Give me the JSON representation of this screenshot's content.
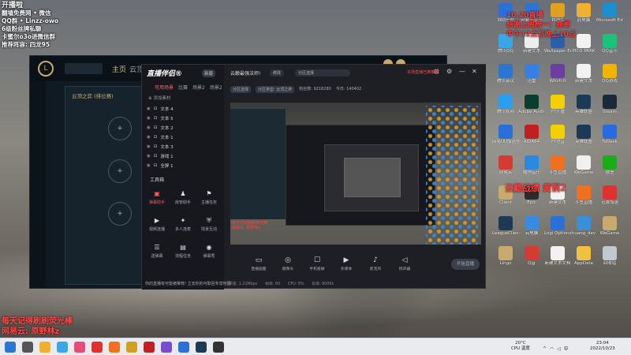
{
  "overlay": {
    "top_left": [
      "开播啦",
      "翻墙免费网 • 微信",
      "QQ群 • Linzz-owo",
      "6级粉丝牌私聊",
      "卡蜜尔o3o进微信群",
      "推荐阵容: 四龙95"
    ],
    "top_right": [
      "10.20直播",
      "感谢上周榜一：鹿哥",
      "中午12点到晚上10点"
    ],
    "mid_right": "云巅战绩   黄铜2",
    "bottom_left": [
      "每天记得刷刷荧光棒",
      "网易云: 原野林z"
    ]
  },
  "lol_client": {
    "logo": "L",
    "nav_home": "主页",
    "nav_cloud": "云顶",
    "panel_title": "云顶之弈 (排位赛)",
    "slot_symbol": "+"
  },
  "stream_app": {
    "title": "直播伴侣®",
    "badge": "新版",
    "tabs": [
      "可用场景",
      "比赛",
      "场景2",
      "场景2"
    ],
    "add_source": "添加素材",
    "layers": [
      "文本 4",
      "文本 5",
      "文本 2",
      "文本 1",
      "文本 3",
      "游戏 1",
      "全屏 1"
    ],
    "tools_title": "工具箱",
    "tools": [
      {
        "icon": "chart-icon",
        "glyph": "▣",
        "label": "弹幕助手"
      },
      {
        "icon": "user-icon",
        "glyph": "♟",
        "label": "房管助手"
      },
      {
        "icon": "flag-icon",
        "glyph": "⚑",
        "label": "主播任务"
      },
      {
        "icon": "video-icon",
        "glyph": "▶",
        "label": "视频连播"
      },
      {
        "icon": "rocket-icon",
        "glyph": "✦",
        "label": "多人连麦"
      },
      {
        "icon": "shield-icon",
        "glyph": "⛨",
        "label": "情景互动"
      },
      {
        "icon": "vote-icon",
        "glyph": "☰",
        "label": "送弹幕"
      },
      {
        "icon": "document-icon",
        "glyph": "▤",
        "label": "流程任务"
      },
      {
        "icon": "camera-icon",
        "glyph": "◉",
        "label": "弹幕秀"
      }
    ],
    "notice": "你的直播有可能被推荐! 立去你的可取回专享地图",
    "room_name": "云巅最强法师!",
    "pill_1": "修改",
    "pill_2": "分区选择",
    "warning": "本场直播已被推荐",
    "info_tags": [
      "分区选择",
      "分区类型: 云顶之弈"
    ],
    "info_values": [
      "粉丝数: 9216280",
      "今日: 140402"
    ],
    "preview_red": [
      "每天记得刷刷荧光棒",
      "网易云: 原野林z"
    ],
    "controls": [
      {
        "icon": "screen-icon",
        "glyph": "▭",
        "label": "直播画面"
      },
      {
        "icon": "camera-icon",
        "glyph": "◎",
        "label": "摄像头"
      },
      {
        "icon": "phone-icon",
        "glyph": "☐",
        "label": "手机投屏"
      },
      {
        "icon": "media-icon",
        "glyph": "▶",
        "label": "多媒体"
      },
      {
        "icon": "mic-icon",
        "glyph": "♪",
        "label": "麦克风"
      },
      {
        "icon": "speaker-icon",
        "glyph": "◁",
        "label": "扬声器"
      }
    ],
    "go_live": "开始直播",
    "status": [
      "带宽:    1.21Mbps",
      "帧率: 60",
      "CPU: 8%",
      "码率: 8000k"
    ]
  },
  "desktop_icons": [
    {
      "label": "360压缩",
      "color": "#2a70d8"
    },
    {
      "label": "网易云音乐",
      "color": "#2a76d2"
    },
    {
      "label": "PUBG",
      "color": "#e0a020"
    },
    {
      "label": "此电脑",
      "color": "#f0b030"
    },
    {
      "label": "Microsoft Edge",
      "color": "#1b8fd1"
    },
    {
      "label": "腾讯QQ",
      "color": "#3aa6e8"
    },
    {
      "label": "新建文本",
      "color": "#eeeeee"
    },
    {
      "label": "Wallpaper Engine",
      "color": "#2b5fa8"
    },
    {
      "label": "PICO PARK",
      "color": "#f2f2f2"
    },
    {
      "label": "QQ音乐",
      "color": "#19c37a"
    },
    {
      "label": "腾讯会议",
      "color": "#2a76d2"
    },
    {
      "label": "迅雷",
      "color": "#3580e0"
    },
    {
      "label": "Witch It",
      "color": "#6b3fa0"
    },
    {
      "label": "新建文本",
      "color": "#f2f2f2"
    },
    {
      "label": "QQ游戏",
      "color": "#f2b400"
    },
    {
      "label": "腾讯视频",
      "color": "#2a9ef0"
    },
    {
      "label": "Adobe Audition",
      "color": "#0b3d2e"
    },
    {
      "label": "YY开播",
      "color": "#f5d000"
    },
    {
      "label": "英雄联盟",
      "color": "#1c3a56"
    },
    {
      "label": "Steam",
      "color": "#1b2838"
    },
    {
      "label": "网易UU加速器",
      "color": "#2a70d8"
    },
    {
      "label": "AIDA64",
      "color": "#c02020"
    },
    {
      "label": "YY语音",
      "color": "#f5d000"
    },
    {
      "label": "英雄联盟",
      "color": "#1c3a56"
    },
    {
      "label": "ToDesk",
      "color": "#2a6ae0"
    },
    {
      "label": "网易云",
      "color": "#d43c33"
    },
    {
      "label": "酷狗音乐",
      "color": "#2a8ae0"
    },
    {
      "label": "斗鱼直播",
      "color": "#f07020"
    },
    {
      "label": "WeGame",
      "color": "#f0f0f0"
    },
    {
      "label": "微信",
      "color": "#1aad19"
    },
    {
      "label": "Client",
      "color": "#c8aa6e"
    },
    {
      "label": "Epic",
      "color": "#2b2b2b"
    },
    {
      "label": "新建文本",
      "color": "#f2f2f2"
    },
    {
      "label": "斗鱼直播",
      "color": "#f07020"
    },
    {
      "label": "迅游加速",
      "color": "#e03030"
    },
    {
      "label": "LeagueClient",
      "color": "#1c3a56"
    },
    {
      "label": "云电脑",
      "color": "#3a8ae0"
    },
    {
      "label": "Logi Options",
      "color": "#2a70d8"
    },
    {
      "label": "huang_dev",
      "color": "#3a90d8"
    },
    {
      "label": "WeGame",
      "color": "#c8aa6e"
    },
    {
      "label": "Lingo",
      "color": "#c8aa6e"
    },
    {
      "label": "Q音",
      "color": "#d43c33"
    },
    {
      "label": "新建文本文档",
      "color": "#f2f2f2"
    },
    {
      "label": "AppData",
      "color": "#f0c040"
    },
    {
      "label": "回收站",
      "color": "#c0c8d0"
    }
  ],
  "taskbar": {
    "apps": [
      {
        "name": "start",
        "color": "#2a76d2"
      },
      {
        "name": "search",
        "color": "#555555"
      },
      {
        "name": "files",
        "color": "#f0b030"
      },
      {
        "name": "qq",
        "color": "#3aa6e8"
      },
      {
        "name": "bilibili",
        "color": "#e84a7a"
      },
      {
        "name": "app5",
        "color": "#e03030"
      },
      {
        "name": "app6",
        "color": "#f07020"
      },
      {
        "name": "app7",
        "color": "#d0a020"
      },
      {
        "name": "app8",
        "color": "#c02020"
      },
      {
        "name": "app9",
        "color": "#7a4ad0"
      },
      {
        "name": "app10",
        "color": "#2a70d8"
      },
      {
        "name": "app11",
        "color": "#1c3a56"
      },
      {
        "name": "app12",
        "color": "#333333"
      }
    ],
    "weather_temp": "20°C",
    "weather_desc": "CPU 温度",
    "time": "23:04",
    "date": "2022/10/23"
  }
}
